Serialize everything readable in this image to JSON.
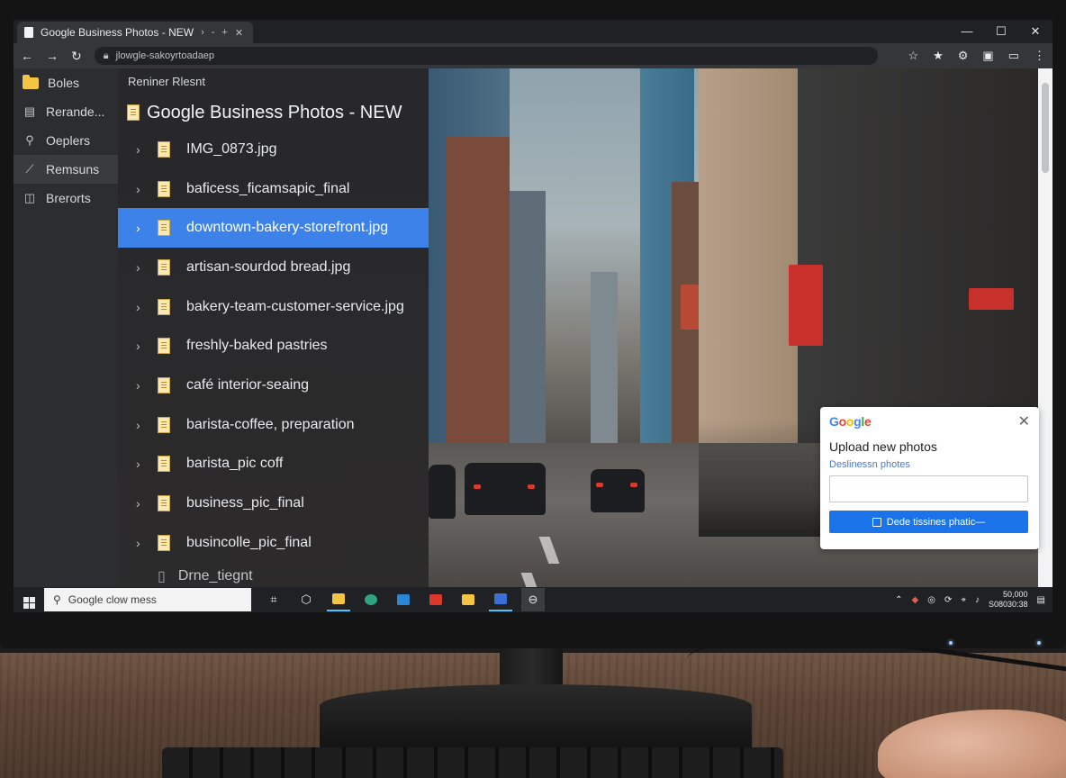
{
  "browser": {
    "tab_title": "Google Business Photos - NEW",
    "tab_controls": [
      "›",
      "-",
      "+"
    ],
    "tab_close": "✕",
    "address": "jlowgle-sakoyrtoadaep"
  },
  "window_controls": {
    "minimize": "—",
    "maximize": "☐",
    "close": "✕"
  },
  "sidebar": {
    "items": [
      {
        "label": "Boles",
        "icon": "folder-icon"
      },
      {
        "label": "Rerande...",
        "icon": "grid-icon"
      },
      {
        "label": "Oeplers",
        "icon": "pin-icon"
      },
      {
        "label": "Remsuns",
        "icon": "chart-icon"
      },
      {
        "label": "Brerorts",
        "icon": "window-icon"
      }
    ]
  },
  "file_pane": {
    "header": "Reniner Rlesnt",
    "title": "Google Business Photos - NEW",
    "files": [
      {
        "name": "IMG_0873.jpg",
        "selected": false
      },
      {
        "name": "baficess_ficamsapic_final",
        "selected": false
      },
      {
        "name": "downtown-bakery-storefront.jpg",
        "selected": true
      },
      {
        "name": "artisan-sourdod bread.jpg",
        "selected": false
      },
      {
        "name": "bakery-team-customer-service.jpg",
        "selected": false
      },
      {
        "name": "freshly-baked pastries",
        "selected": false
      },
      {
        "name": "café interior-seaing",
        "selected": false
      },
      {
        "name": "barista-coffee, preparation",
        "selected": false
      },
      {
        "name": "barista_pic coff",
        "selected": false
      },
      {
        "name": "business_pic_final",
        "selected": false
      },
      {
        "name": "busincolle_pic_final",
        "selected": false
      }
    ],
    "partial_row": "Drne_tiegnt"
  },
  "popup": {
    "brand": [
      "G",
      "o",
      "o",
      "g",
      "l",
      "e"
    ],
    "title": "Upload new photos",
    "subtitle": "Deslinessn photes",
    "input_value": "",
    "button_label": "Dede tissines phatic—",
    "close": "✕"
  },
  "taskbar": {
    "search_placeholder": "Google clow mess",
    "clock_time": "50,000",
    "clock_date": "S08030:38"
  },
  "colors": {
    "selection": "#3d82e8",
    "button": "#1a73e8",
    "subtitle": "#4a78c9"
  }
}
